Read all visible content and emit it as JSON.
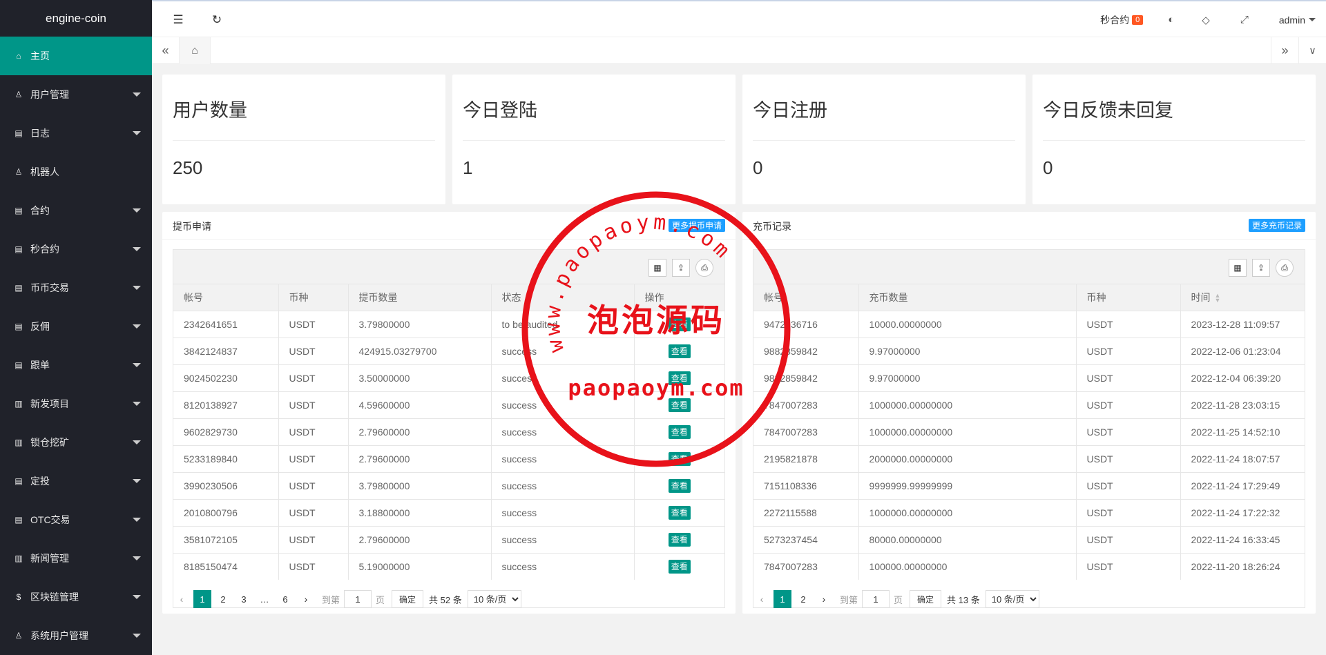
{
  "app": {
    "title": "engine-coin"
  },
  "sidebar": {
    "items": [
      {
        "label": "主页",
        "icon": "home-icon",
        "active": true,
        "caret": false
      },
      {
        "label": "用户管理",
        "icon": "user-icon",
        "caret": true
      },
      {
        "label": "日志",
        "icon": "doc-icon",
        "caret": true
      },
      {
        "label": "机器人",
        "icon": "user-icon",
        "caret": false
      },
      {
        "label": "合约",
        "icon": "doc-icon",
        "caret": true
      },
      {
        "label": "秒合约",
        "icon": "doc-icon",
        "caret": true
      },
      {
        "label": "币币交易",
        "icon": "doc-icon",
        "caret": true
      },
      {
        "label": "反佣",
        "icon": "doc-icon",
        "caret": true
      },
      {
        "label": "跟单",
        "icon": "doc-icon",
        "caret": true
      },
      {
        "label": "新发项目",
        "icon": "news-icon",
        "caret": true
      },
      {
        "label": "锁仓挖矿",
        "icon": "news-icon",
        "caret": true
      },
      {
        "label": "定投",
        "icon": "doc-icon",
        "caret": true
      },
      {
        "label": "OTC交易",
        "icon": "doc-icon",
        "caret": true
      },
      {
        "label": "新闻管理",
        "icon": "news-icon",
        "caret": true
      },
      {
        "label": "区块链管理",
        "icon": "coin-icon",
        "caret": true
      },
      {
        "label": "系统用户管理",
        "icon": "user-icon",
        "caret": true
      }
    ]
  },
  "header": {
    "second_contract_label": "秒合约",
    "second_contract_badge": "0",
    "user": "admin"
  },
  "stats": [
    {
      "title": "用户数量",
      "value": "250"
    },
    {
      "title": "今日登陆",
      "value": "1"
    },
    {
      "title": "今日注册",
      "value": "0"
    },
    {
      "title": "今日反馈未回复",
      "value": "0"
    }
  ],
  "withdraw": {
    "title": "提币申请",
    "more_label": "更多提币申请",
    "columns": [
      "帐号",
      "币种",
      "提币数量",
      "状态",
      "操作"
    ],
    "view_label": "查看",
    "rows": [
      [
        "2342641651",
        "USDT",
        "3.79800000",
        "to be audited"
      ],
      [
        "3842124837",
        "USDT",
        "424915.03279700",
        "success"
      ],
      [
        "9024502230",
        "USDT",
        "3.50000000",
        "success"
      ],
      [
        "8120138927",
        "USDT",
        "4.59600000",
        "success"
      ],
      [
        "9602829730",
        "USDT",
        "2.79600000",
        "success"
      ],
      [
        "5233189840",
        "USDT",
        "2.79600000",
        "success"
      ],
      [
        "3990230506",
        "USDT",
        "3.79800000",
        "success"
      ],
      [
        "2010800796",
        "USDT",
        "3.18800000",
        "success"
      ],
      [
        "3581072105",
        "USDT",
        "2.79600000",
        "success"
      ],
      [
        "8185150474",
        "USDT",
        "5.19000000",
        "success"
      ]
    ],
    "pager": {
      "pages": [
        "1",
        "2",
        "3",
        "…",
        "6"
      ],
      "goto_label": "到第",
      "goto_value": "1",
      "page_label": "页",
      "ok_label": "确定",
      "total": "共 52 条",
      "size": "10 条/页"
    }
  },
  "recharge": {
    "title": "充币记录",
    "more_label": "更多充币记录",
    "columns": [
      "帐号",
      "充币数量",
      "币种",
      "时间"
    ],
    "rows": [
      [
        "9472936716",
        "10000.00000000",
        "USDT",
        "2023-12-28 11:09:57"
      ],
      [
        "9882859842",
        "9.97000000",
        "USDT",
        "2022-12-06 01:23:04"
      ],
      [
        "9882859842",
        "9.97000000",
        "USDT",
        "2022-12-04 06:39:20"
      ],
      [
        "7847007283",
        "1000000.00000000",
        "USDT",
        "2022-11-28 23:03:15"
      ],
      [
        "7847007283",
        "1000000.00000000",
        "USDT",
        "2022-11-25 14:52:10"
      ],
      [
        "2195821878",
        "2000000.00000000",
        "USDT",
        "2022-11-24 18:07:57"
      ],
      [
        "7151108336",
        "9999999.99999999",
        "USDT",
        "2022-11-24 17:29:49"
      ],
      [
        "2272115588",
        "1000000.00000000",
        "USDT",
        "2022-11-24 17:22:32"
      ],
      [
        "5273237454",
        "80000.00000000",
        "USDT",
        "2022-11-24 16:33:45"
      ],
      [
        "7847007283",
        "100000.00000000",
        "USDT",
        "2022-11-20 18:26:24"
      ]
    ],
    "pager": {
      "pages": [
        "1",
        "2"
      ],
      "goto_label": "到第",
      "goto_value": "1",
      "page_label": "页",
      "ok_label": "确定",
      "total": "共 13 条",
      "size": "10 条/页"
    }
  },
  "watermark": {
    "top_text": "www.paopaoym.com",
    "center_text": "泡泡源码",
    "bottom_text": "paopaoym.com",
    "color": "#e8121a"
  },
  "colors": {
    "accent": "#009688",
    "sidebar": "#20222a",
    "blue": "#1e9fff",
    "badge": "#ff5722"
  }
}
